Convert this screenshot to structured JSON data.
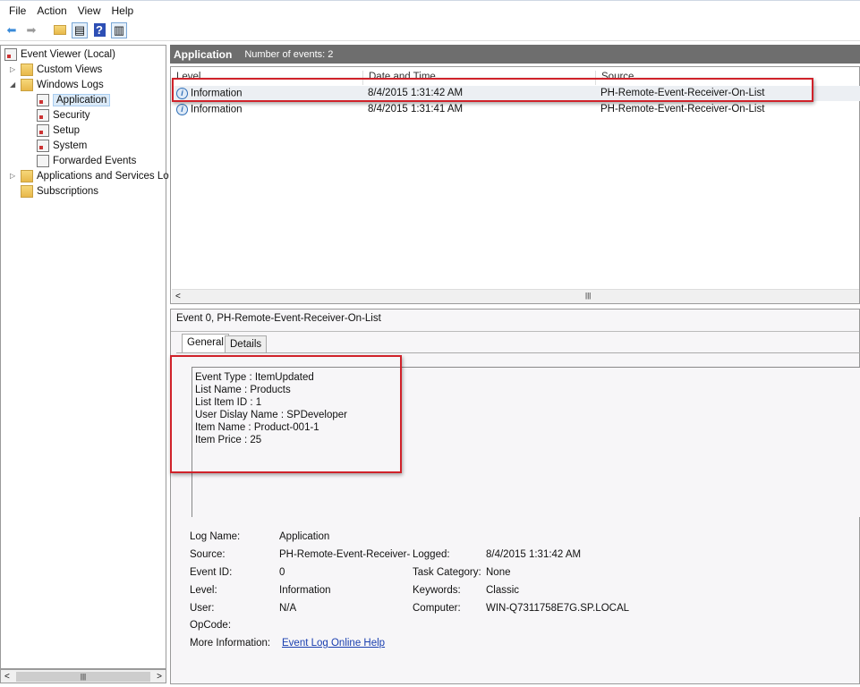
{
  "menu": [
    "File",
    "Action",
    "View",
    "Help"
  ],
  "toolbar": {
    "icons": [
      "back-arrow-icon",
      "forward-arrow-icon",
      "folder-up-icon",
      "show-hide-console-tree-icon",
      "help-icon",
      "show-hide-action-pane-icon"
    ]
  },
  "tree": {
    "root": "Event Viewer (Local)",
    "custom_views": "Custom Views",
    "windows_logs": "Windows Logs",
    "logs": [
      "Application",
      "Security",
      "Setup",
      "System",
      "Forwarded Events"
    ],
    "apps_services": "Applications and Services Lo",
    "subscriptions": "Subscriptions"
  },
  "header": {
    "title": "Application",
    "count": "Number of events: 2"
  },
  "list": {
    "columns": [
      "Level",
      "Date and Time",
      "Source"
    ],
    "rows": [
      {
        "level": "Information",
        "datetime": "8/4/2015 1:31:42 AM",
        "source": "PH-Remote-Event-Receiver-On-List"
      },
      {
        "level": "Information",
        "datetime": "8/4/2015 1:31:41 AM",
        "source": "PH-Remote-Event-Receiver-On-List"
      }
    ]
  },
  "detail": {
    "title": "Event 0, PH-Remote-Event-Receiver-On-List",
    "tabs": [
      "General",
      "Details"
    ],
    "message": [
      "Event Type : ItemUpdated",
      "List Name : Products",
      "List Item ID : 1",
      "User Dislay Name : SPDeveloper",
      "Item Name : Product-001-1",
      "Item Price : 25"
    ],
    "fields": {
      "log_name_label": "Log Name:",
      "log_name": "Application",
      "source_label": "Source:",
      "source": "PH-Remote-Event-Receiver-",
      "event_id_label": "Event ID:",
      "event_id": "0",
      "level_label": "Level:",
      "level": "Information",
      "user_label": "User:",
      "user": "N/A",
      "opcode_label": "OpCode:",
      "more_info_label": "More Information:",
      "more_info_link": "Event Log Online Help",
      "logged_label": "Logged:",
      "logged": "8/4/2015 1:31:42 AM",
      "task_label": "Task Category:",
      "task": "None",
      "keywords_label": "Keywords:",
      "keywords": "Classic",
      "computer_label": "Computer:",
      "computer": "WIN-Q7311758E7G.SP.LOCAL"
    }
  },
  "colors": {
    "header_bg": "#6e6e6e",
    "highlight": "#d0222a",
    "link": "#1a3fb0"
  }
}
